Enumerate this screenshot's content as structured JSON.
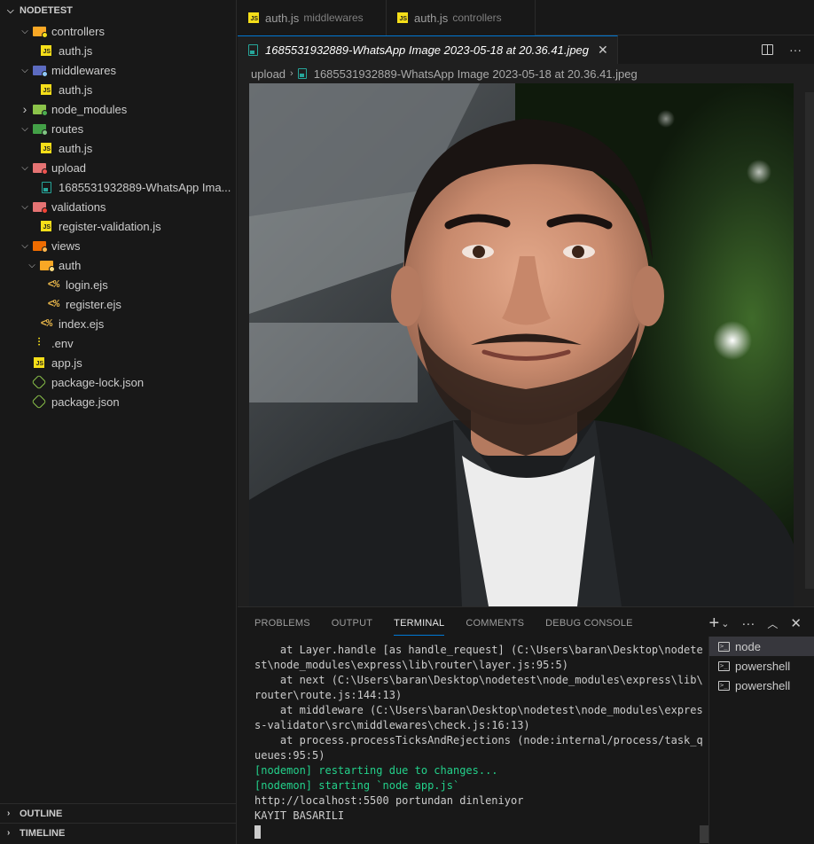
{
  "explorer": {
    "title": "NODETEST",
    "tree": [
      {
        "depth": 0,
        "type": "folder",
        "open": true,
        "label": "controllers",
        "icon": "folder-controllers-icon",
        "color": "#f9a825",
        "badge": "#f5de19"
      },
      {
        "depth": 1,
        "type": "js",
        "label": "auth.js"
      },
      {
        "depth": 0,
        "type": "folder",
        "open": true,
        "label": "middlewares",
        "icon": "folder-middleware-icon",
        "color": "#5c6bc0",
        "badge": "#90caf9"
      },
      {
        "depth": 1,
        "type": "js",
        "label": "auth.js"
      },
      {
        "depth": 0,
        "type": "folder",
        "open": false,
        "label": "node_modules",
        "icon": "folder-node-icon",
        "color": "#8bc34a",
        "badge": "#4caf50"
      },
      {
        "depth": 0,
        "type": "folder",
        "open": true,
        "label": "routes",
        "icon": "folder-routes-icon",
        "color": "#43a047",
        "badge": "#81c784"
      },
      {
        "depth": 1,
        "type": "js",
        "label": "auth.js"
      },
      {
        "depth": 0,
        "type": "folder",
        "open": true,
        "label": "upload",
        "icon": "folder-upload-icon",
        "color": "#e57373",
        "badge": "#ef5350"
      },
      {
        "depth": 1,
        "type": "img",
        "label": "1685531932889-WhatsApp Ima..."
      },
      {
        "depth": 0,
        "type": "folder",
        "open": true,
        "label": "validations",
        "icon": "folder-validations-icon",
        "color": "#e57373",
        "badge": "#f44336"
      },
      {
        "depth": 1,
        "type": "js",
        "label": "register-validation.js"
      },
      {
        "depth": 0,
        "type": "folder",
        "open": true,
        "label": "views",
        "icon": "folder-views-icon",
        "color": "#ef6c00",
        "badge": "#ffb74d"
      },
      {
        "depth": 1,
        "type": "folder",
        "open": true,
        "label": "auth",
        "icon": "folder-auth-icon",
        "color": "#f9a825",
        "badge": "#ffe082"
      },
      {
        "depth": 2,
        "type": "ejs",
        "label": "login.ejs"
      },
      {
        "depth": 2,
        "type": "ejs",
        "label": "register.ejs"
      },
      {
        "depth": 1,
        "type": "ejs",
        "label": "index.ejs"
      },
      {
        "depth": 0,
        "type": "env",
        "label": ".env"
      },
      {
        "depth": 0,
        "type": "js",
        "label": "app.js"
      },
      {
        "depth": 0,
        "type": "json",
        "label": "package-lock.json"
      },
      {
        "depth": 0,
        "type": "json",
        "label": "package.json"
      }
    ],
    "outline_label": "OUTLINE",
    "timeline_label": "TIMELINE"
  },
  "tabs": [
    {
      "label": "auth.js",
      "description": "middlewares"
    },
    {
      "label": "auth.js",
      "description": "controllers"
    }
  ],
  "active_tab": {
    "label": "1685531932889-WhatsApp Image 2023-05-18 at 20.36.41.jpeg",
    "close": "✕"
  },
  "breadcrumb": {
    "folder": "upload",
    "separator": "›",
    "file": "1685531932889-WhatsApp Image 2023-05-18 at 20.36.41.jpeg"
  },
  "editor_actions": {
    "more": "···"
  },
  "panel": {
    "tabs": [
      "PROBLEMS",
      "OUTPUT",
      "TERMINAL",
      "COMMENTS",
      "DEBUG CONSOLE"
    ],
    "active_tab": "TERMINAL",
    "actions": {
      "add": "+",
      "dropdown": "⌄",
      "more": "···",
      "maximize": "︿",
      "close": "✕"
    }
  },
  "terminal": {
    "lines": [
      {
        "text": "    at Layer.handle [as handle_request] (C:\\Users\\baran\\Desktop\\nodete",
        "color": "default"
      },
      {
        "text": "st\\node_modules\\express\\lib\\router\\layer.js:95:5)",
        "color": "default"
      },
      {
        "text": "    at next (C:\\Users\\baran\\Desktop\\nodetest\\node_modules\\express\\lib\\",
        "color": "default"
      },
      {
        "text": "router\\route.js:144:13)",
        "color": "default"
      },
      {
        "text": "    at middleware (C:\\Users\\baran\\Desktop\\nodetest\\node_modules\\expres",
        "color": "default"
      },
      {
        "text": "s-validator\\src\\middlewares\\check.js:16:13)",
        "color": "default"
      },
      {
        "text": "    at process.processTicksAndRejections (node:internal/process/task_q",
        "color": "default"
      },
      {
        "text": "ueues:95:5)",
        "color": "default"
      },
      {
        "text": "[nodemon] restarting due to changes...",
        "color": "green"
      },
      {
        "text": "[nodemon] starting `node app.js`",
        "color": "green"
      },
      {
        "text": "http://localhost:5500 portundan dinleniyor",
        "color": "default"
      },
      {
        "text": "KAYIT BASARILI",
        "color": "default"
      }
    ],
    "sessions": [
      "node",
      "powershell",
      "powershell"
    ],
    "active_session": 0
  },
  "colors": {
    "accent": "#0078d4",
    "terminal_green": "#23d18b",
    "js_yellow": "#f5de19"
  }
}
